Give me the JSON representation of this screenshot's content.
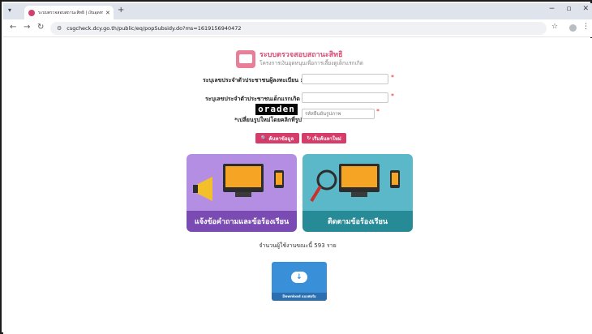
{
  "browser": {
    "tab_title": "ระบบตรวจสอบสถานะสิทธิ | เงินอุดหนุน...",
    "url": "csgcheck.dcy.go.th/public/eq/popSubsidy.do?ms=1619156940472"
  },
  "header": {
    "title": "ระบบตรวจสอบสถานะสิทธิ",
    "subtitle": "โครงการเงินอุดหนุนเพื่อการเลี้ยงดูเด็กแรกเกิด"
  },
  "form": {
    "registrant_id_label": "ระบุเลขประจำตัวประชาชนผู้ลงทะเบียน :",
    "child_id_label": "ระบุเลขประจำตัวประชาชนเด็กแรกเกิด :",
    "captcha_text": "oraden",
    "captcha_placeholder": "รหัสยืนยันรูปภาพ",
    "captcha_hint": "*เปลี่ยนรูปใหม่โดยคลิกที่รูป",
    "required_mark": "*",
    "search_label": "ค้นหาข้อมูล",
    "reset_label": "เริ่มค้นหาใหม่"
  },
  "cards": {
    "complaint_label": "แจ้งข้อคำถามและข้อร้องเรียน",
    "track_label": "ติดตามข้อร้องเรียน"
  },
  "counter_text": "จำนวนผู้ใช้งานขณะนี้ 593 ราย",
  "download_label": "Download แบบฟอร์ม",
  "colors": {
    "brand_pink": "#d63c6a",
    "card_purple": "#b48ee2",
    "card_teal": "#5bb8c8"
  }
}
